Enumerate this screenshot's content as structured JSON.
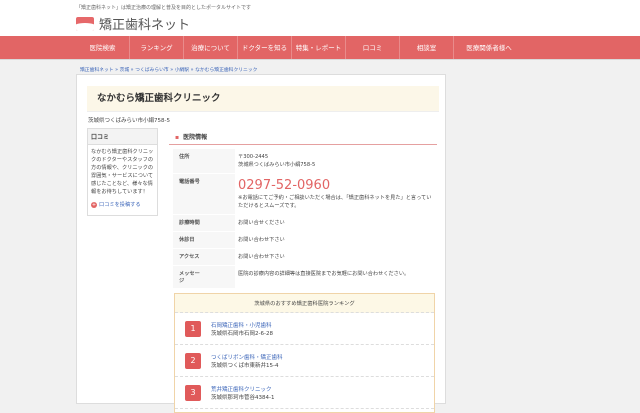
{
  "header": {
    "tagline": "「矯正歯科ネット」は矯正治療の理解と普及を目的としたポータルサイトです",
    "logo": "矯正歯科ネット"
  },
  "nav": [
    "医院検索",
    "ランキング",
    "治療について",
    "ドクターを知る",
    "特集・レポート",
    "口コミ",
    "相談室",
    "医療関係者様へ"
  ],
  "breadcrumb": "矯正歯科ネット » 茨城 » つくばみらい市 » 小絹駅 » なかむら矯正歯科クリニック",
  "clinic": {
    "name": "なかむら矯正歯科クリニック",
    "address": "茨城県つくばみらい市小絹758-5"
  },
  "sidebar": {
    "title": "口コミ",
    "text": "なかむら矯正歯科クリニックのドクターやスタッフの方の情報や、クリニックの雰囲気・サービスについて感じたことなど、様々な情報をお待ちしています！",
    "post": "口コミを投稿する"
  },
  "section": {
    "title": "医院情報"
  },
  "info": [
    {
      "k": "住所",
      "v": "〒300-2445",
      "v2": "茨城県つくばみらい市小絹758-5"
    },
    {
      "k": "電話番号",
      "tel": "0297-52-0960",
      "v": "※お電話にてご予約・ご相談いただく場合は、「矯正歯科ネットを見た」と言っていただけるとスムーズです。"
    },
    {
      "k": "診療時間",
      "v": "お問い合せください"
    },
    {
      "k": "休診日",
      "v": "お問い合わせ下さい"
    },
    {
      "k": "アクセス",
      "v": "お問い合わせ下さい"
    },
    {
      "k": "メッセージ",
      "v": "医院の診療内容の詳細等は直接医院までお気軽にお問い合わせください。"
    }
  ],
  "ranking": {
    "title": "茨城県のおすすめ矯正歯科医院ランキング",
    "items": [
      {
        "n": "1",
        "name": "石岡矯正歯科・小児歯科",
        "addr": "茨城県石岡市石岡2-6-28"
      },
      {
        "n": "2",
        "name": "つくばリボン歯科・矯正歯科",
        "addr": "茨城県つくば市東新井15-4"
      },
      {
        "n": "3",
        "name": "荒井矯正歯科クリニック",
        "addr": "茨城県那珂市菅谷4384-1"
      }
    ]
  }
}
